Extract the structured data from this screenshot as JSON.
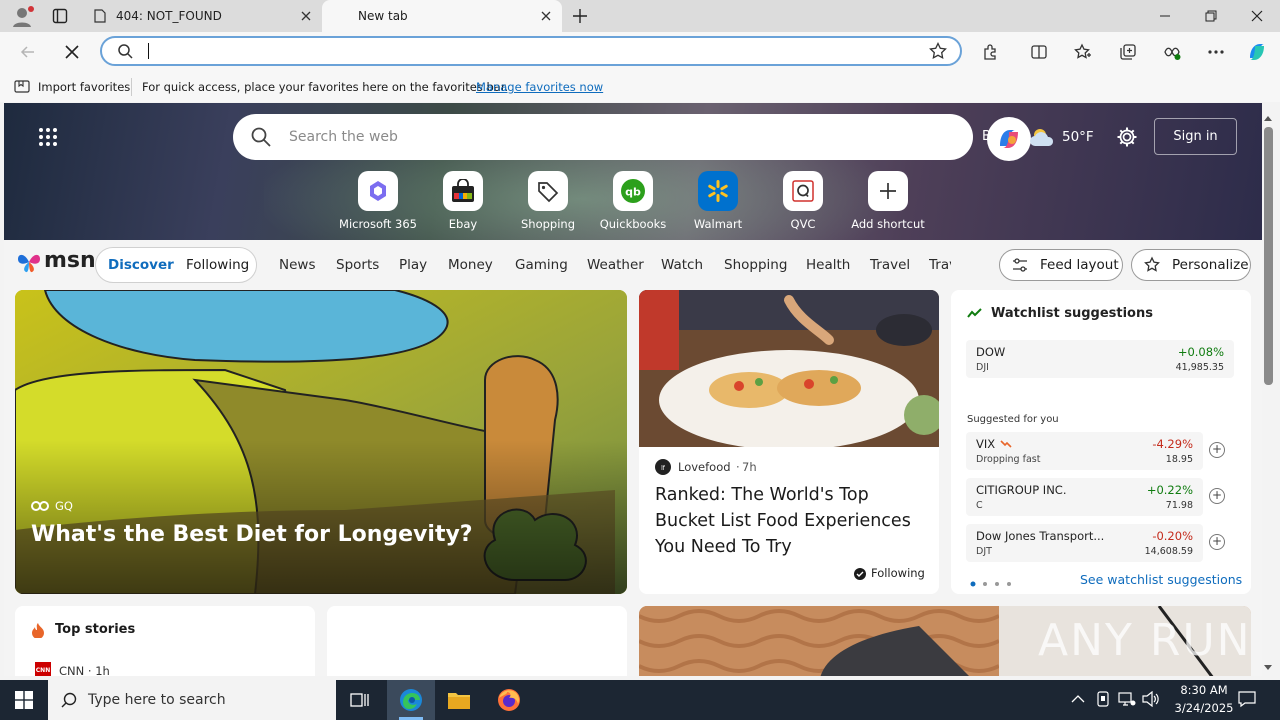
{
  "browser": {
    "tabs": [
      {
        "title": "404: NOT_FOUND"
      },
      {
        "title": "New tab"
      }
    ],
    "address_placeholder": ""
  },
  "favorites_bar": {
    "import_label": "Import favorites",
    "hint": "For quick access, place your favorites here on the favorites bar.",
    "manage_link": "Manage favorites now"
  },
  "hero": {
    "search_placeholder": "Search the web",
    "weather_city": "Berlin",
    "temperature": "50°F",
    "signin_label": "Sign in",
    "shortcuts": [
      {
        "label": "Microsoft 365"
      },
      {
        "label": "Ebay"
      },
      {
        "label": "Shopping"
      },
      {
        "label": "Quickbooks"
      },
      {
        "label": "Walmart"
      },
      {
        "label": "QVC"
      },
      {
        "label": "Add shortcut"
      }
    ]
  },
  "nav": {
    "brand": "msn",
    "discover": "Discover",
    "following": "Following",
    "items": [
      "News",
      "Sports",
      "Play",
      "Money",
      "Gaming",
      "Weather",
      "Watch",
      "Shopping",
      "Health",
      "Travel",
      "Trav"
    ],
    "feed_layout": "Feed layout",
    "personalize": "Personalize"
  },
  "big_card": {
    "source": "GQ",
    "title": "What's the Best Diet for Longevity?"
  },
  "food_card": {
    "source": "Lovefood",
    "time": "7h",
    "title": "Ranked: The World's Top Bucket List Food Experiences You Need To Try",
    "follow_label": "Following"
  },
  "watchlist": {
    "title": "Watchlist suggestions",
    "main": {
      "name": "DOW",
      "symbol": "DJI",
      "change": "+0.08%",
      "value": "41,985.35"
    },
    "suggested_label": "Suggested for you",
    "suggested": [
      {
        "name": "VIX",
        "symbol": "Dropping fast",
        "change": "-4.29%",
        "value": "18.95"
      },
      {
        "name": "CITIGROUP INC.",
        "symbol": "C",
        "change": "+0.22%",
        "value": "71.98"
      },
      {
        "name": "Dow Jones Transport...",
        "symbol": "DJT",
        "change": "-0.20%",
        "value": "14,608.59"
      }
    ],
    "see_link": "See watchlist suggestions"
  },
  "top_stories": {
    "title": "Top stories",
    "source": "CNN · 1h"
  },
  "watermark": "ANY RUN",
  "taskbar": {
    "search_placeholder": "Type here to search",
    "time": "8:30 AM",
    "date": "3/24/2025"
  },
  "colors": {
    "accent": "#0f6cbd",
    "positive": "#107c10",
    "negative": "#c42b1c"
  }
}
